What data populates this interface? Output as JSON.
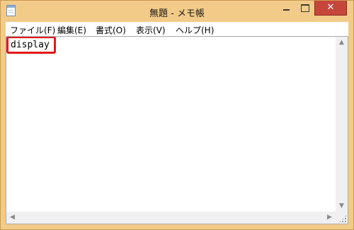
{
  "window": {
    "title": "無題 - メモ帳",
    "close_glyph": "✕"
  },
  "menu": {
    "items": [
      {
        "label": "ファイル(F)"
      },
      {
        "label": "編集(E)"
      },
      {
        "label": "書式(O)"
      },
      {
        "label": "表示(V)"
      },
      {
        "label": "ヘルプ(H)"
      }
    ]
  },
  "editor": {
    "content": "display"
  },
  "scrollbars": {
    "up_glyph": "▲",
    "down_glyph": "▼",
    "left_glyph": "◀",
    "right_glyph": "▶"
  },
  "colors": {
    "frame": "#f2cb88",
    "close_button": "#c7463c",
    "highlight": "#e21a1a"
  }
}
